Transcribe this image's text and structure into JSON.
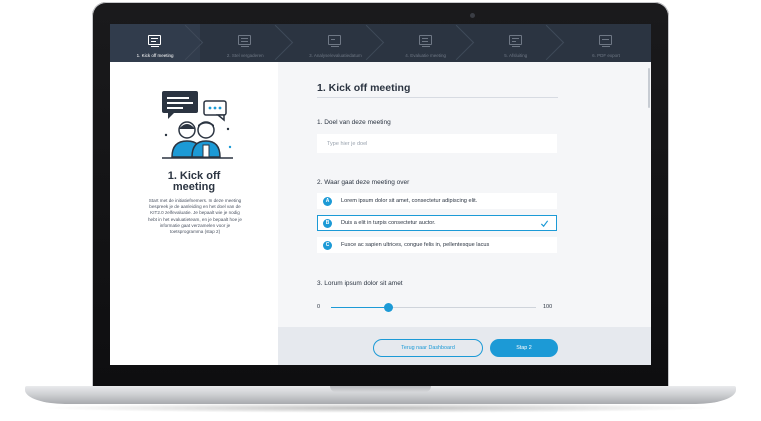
{
  "stepper": {
    "steps": [
      {
        "label": "1. Kick off meeting",
        "active": true
      },
      {
        "label": "2. Stel vergaderen",
        "active": false
      },
      {
        "label": "3. Analyse/evaluatiedatum",
        "active": false
      },
      {
        "label": "4. Evaluatie meeting",
        "active": false
      },
      {
        "label": "5. Afsluiting",
        "active": false
      },
      {
        "label": "6. PDF export",
        "active": false
      }
    ]
  },
  "left": {
    "title_line1": "1. Kick off",
    "title_line2": "meeting",
    "description": "Start met de initiatiefnemers. In deze meeting bespreek je de aanleiding en het doel van de KIT2.0 zelfevaluatie. Je bepaalt wie je nodig hebt in het evaluatieteam, en je bepaalt hoe je informatie gaat verzamelen voor je toetsprogramma (stap 2)"
  },
  "main": {
    "title": "1. Kick off meeting",
    "q1": {
      "label": "1. Doel van deze meeting",
      "placeholder": "Type hier je doel",
      "value": ""
    },
    "q2": {
      "label": "2. Waar gaat deze meeting over",
      "options": [
        {
          "badge": "A",
          "text": "Lorem ipsum dolor sit amet, consectetur adipiscing elit.",
          "selected": false
        },
        {
          "badge": "B",
          "text": "Duis a elit in turpis consectetur auctor.",
          "selected": true
        },
        {
          "badge": "C",
          "text": "Fusce ac sapien ultrices, congue felis in, pellentesque lacus",
          "selected": false
        }
      ]
    },
    "q3": {
      "label": "3. Lorum ipsum dolor sit amet",
      "min": "0",
      "max": "100",
      "value": 28
    }
  },
  "footer": {
    "back_label": "Terug naar Dashboard",
    "next_label": "Stap 2"
  },
  "colors": {
    "accent": "#1c9ad6",
    "header_bg": "#2b3441",
    "text_dark": "#2b3441"
  }
}
